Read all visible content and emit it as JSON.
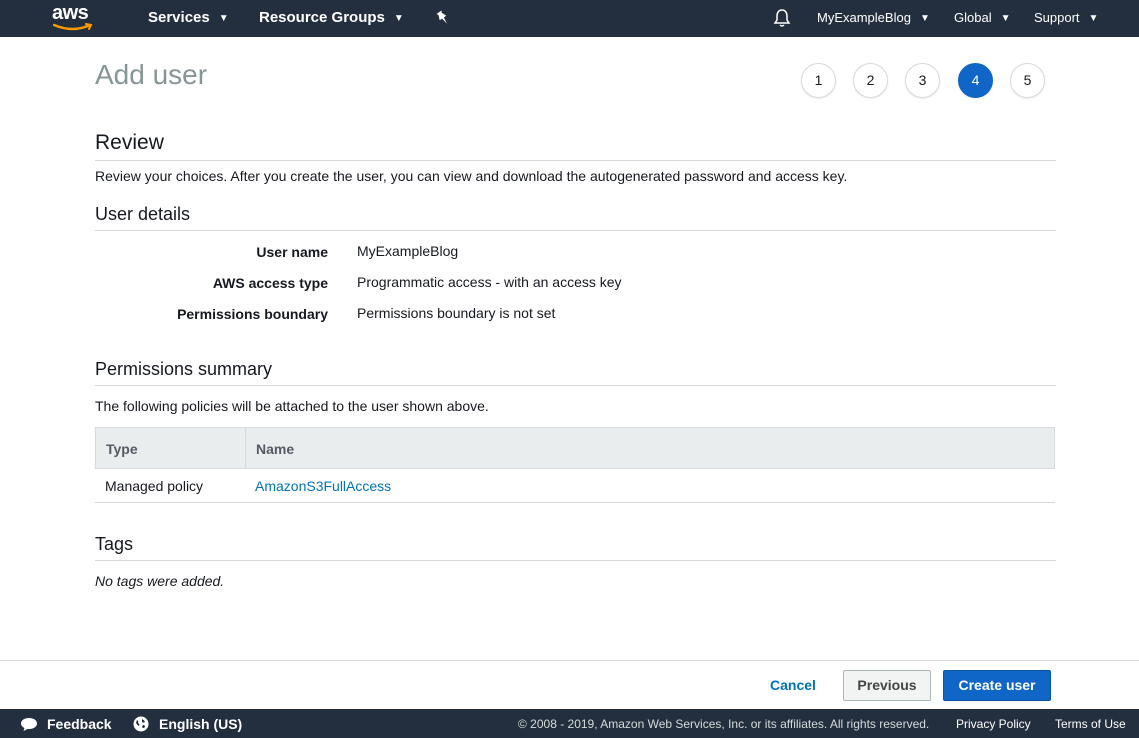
{
  "colors": {
    "nav_bg": "#232f3e",
    "accent": "#0f66c6",
    "link": "#0073bb",
    "aws_orange": "#ff9900"
  },
  "topnav": {
    "logo_text": "aws",
    "services": "Services",
    "resource_groups": "Resource Groups",
    "account": "MyExampleBlog",
    "region": "Global",
    "support": "Support",
    "icons": [
      "pin-icon",
      "bell-icon"
    ]
  },
  "page": {
    "title": "Add user",
    "steps": [
      "1",
      "2",
      "3",
      "4",
      "5"
    ],
    "active_step": "4"
  },
  "review": {
    "heading": "Review",
    "description": "Review your choices. After you create the user, you can view and download the autogenerated password and access key."
  },
  "user_details": {
    "heading": "User details",
    "rows": [
      {
        "label": "User name",
        "value": "MyExampleBlog"
      },
      {
        "label": "AWS access type",
        "value": "Programmatic access - with an access key"
      },
      {
        "label": "Permissions boundary",
        "value": "Permissions boundary is not set"
      }
    ]
  },
  "permissions": {
    "heading": "Permissions summary",
    "description": "The following policies will be attached to the user shown above.",
    "columns": [
      "Type",
      "Name"
    ],
    "rows": [
      {
        "type": "Managed policy",
        "name": "AmazonS3FullAccess"
      }
    ]
  },
  "tags": {
    "heading": "Tags",
    "empty_text": "No tags were added."
  },
  "actions": {
    "cancel": "Cancel",
    "previous": "Previous",
    "create": "Create user"
  },
  "footer": {
    "feedback": "Feedback",
    "language": "English (US)",
    "copyright": "© 2008 - 2019, Amazon Web Services, Inc. or its affiliates. All rights reserved.",
    "privacy": "Privacy Policy",
    "terms": "Terms of Use"
  }
}
